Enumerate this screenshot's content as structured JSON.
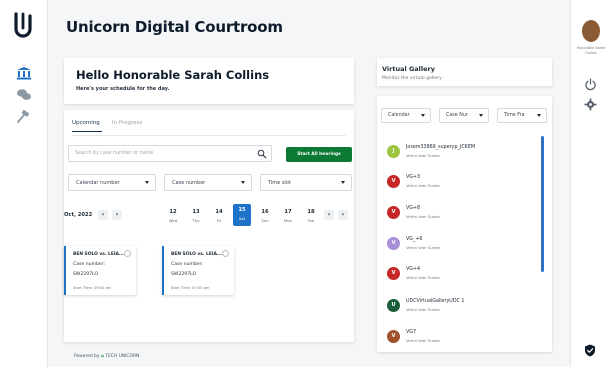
{
  "app": {
    "title": "Unicorn Digital Courtroom"
  },
  "greeting": {
    "title": "Hello Honorable Sarah Collins",
    "subtitle": "Here's your schedule for the day."
  },
  "tabs": [
    {
      "label": "Upcoming",
      "active": true
    },
    {
      "label": "In Progress",
      "active": false
    }
  ],
  "search": {
    "placeholder": "Search by case number or name"
  },
  "start_button": {
    "label": "Start All hearings"
  },
  "filters": [
    {
      "label": "Calendar number"
    },
    {
      "label": "Case number"
    },
    {
      "label": "Time slot"
    }
  ],
  "calendar": {
    "month": "Oct, 2022",
    "days": [
      {
        "num": "12",
        "name": "Wed"
      },
      {
        "num": "13",
        "name": "Thu"
      },
      {
        "num": "14",
        "name": "Fri"
      },
      {
        "num": "15",
        "name": "Sat",
        "selected": true
      },
      {
        "num": "16",
        "name": "Sun"
      },
      {
        "num": "17",
        "name": "Mon"
      },
      {
        "num": "18",
        "name": "Tue"
      }
    ]
  },
  "hearings": [
    {
      "title": "BEN SOLO vs. LEIA...",
      "case_label": "Case number:",
      "case_number": "SW2297LO",
      "time": "Start Time: 09:00 am"
    },
    {
      "title": "BEN SOLO vs. LEIA...",
      "case_label": "Case number:",
      "case_number": "SW2297LO",
      "time": "Start Time: 07:00 pm"
    }
  ],
  "footer": {
    "prefix": "Powered by",
    "brand": "TECH UNICORN"
  },
  "gallery": {
    "title": "Virtual Gallery",
    "subtitle": "Monitor the virtual gallery",
    "filters": [
      {
        "label": "Calendar"
      },
      {
        "label": "Case Nur"
      },
      {
        "label": "Time Fra"
      }
    ],
    "items": [
      {
        "initials": "J",
        "name": "Josem33869_superyp_JCKEM",
        "host": "Vehra Veer Suede",
        "color": "#9bc53d"
      },
      {
        "initials": "V",
        "name": "VG+3",
        "host": "Vehra Veer Suede",
        "color": "#c62828"
      },
      {
        "initials": "V",
        "name": "VG+8",
        "host": "Vehra Veer Suede",
        "color": "#c62828"
      },
      {
        "initials": "V",
        "name": "VG_+6",
        "host": "Vehra Veer Suede",
        "color": "#a88fd8"
      },
      {
        "initials": "V",
        "name": "VG+4",
        "host": "Vehra Veer Suede",
        "color": "#c62828"
      },
      {
        "initials": "U",
        "name": "UDCVirtualGalleryUDC 1",
        "host": "Vehra Veer Suede",
        "color": "#1b5e3a"
      },
      {
        "initials": "V",
        "name": "VG7",
        "host": "Vehra Veer Suede",
        "color": "#a0522d"
      }
    ]
  },
  "profile": {
    "name": "Honorable Sarah Collins"
  },
  "colors": {
    "accent": "#1e73c9",
    "primary_action": "#0c7a35",
    "brand_dark": "#0e1b2b"
  }
}
